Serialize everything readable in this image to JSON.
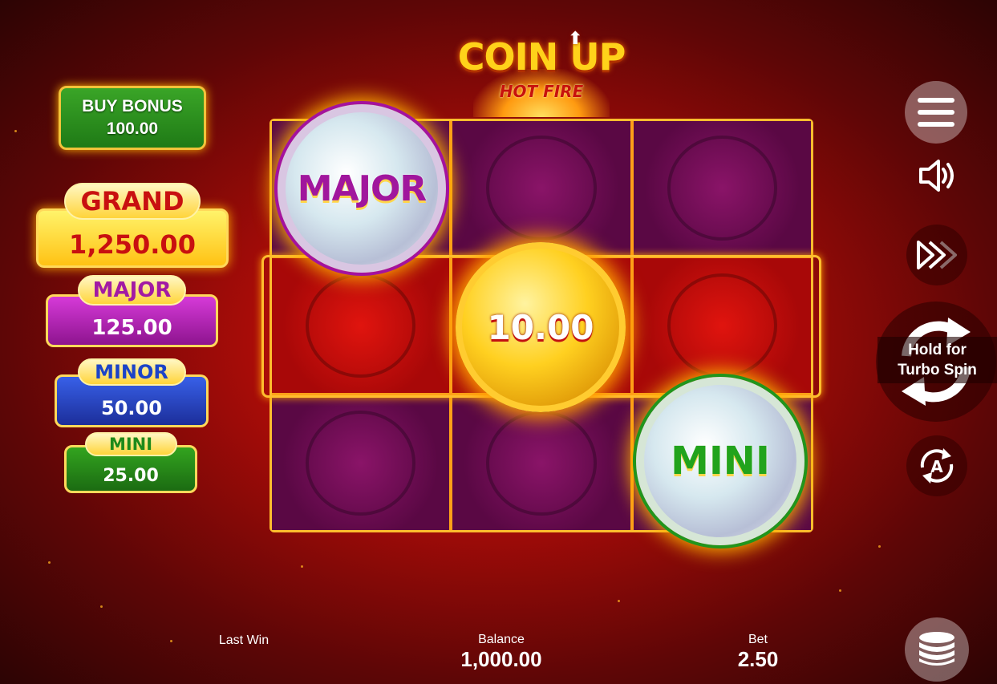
{
  "logo": {
    "title": "COIN UP",
    "subtitle": "HOT FIRE"
  },
  "buy_bonus": {
    "label": "BUY BONUS",
    "price": "100.00"
  },
  "jackpots": [
    {
      "name": "GRAND",
      "value": "1,250.00"
    },
    {
      "name": "MAJOR",
      "value": "125.00"
    },
    {
      "name": "MINOR",
      "value": "50.00"
    },
    {
      "name": "MINI",
      "value": "25.00"
    }
  ],
  "reels": {
    "rows": [
      [
        "purple",
        "purple",
        "purple"
      ],
      [
        "red",
        "red",
        "red"
      ],
      [
        "purple",
        "purple",
        "purple"
      ]
    ],
    "coins": [
      {
        "type": "jackpot",
        "label": "MAJOR",
        "row": 0,
        "col": 0
      },
      {
        "type": "cash",
        "label": "10.00",
        "row": 1,
        "col": 1
      },
      {
        "type": "jackpot",
        "label": "MINI",
        "row": 2,
        "col": 2
      }
    ]
  },
  "controls": {
    "menu_icon": "hamburger-menu-icon",
    "sound_icon": "speaker-icon",
    "fast_icon": "fast-forward-icon",
    "spin_icon": "spin-arrows-icon",
    "spin_hint_line1": "Hold for",
    "spin_hint_line2": "Turbo Spin",
    "auto_icon": "autoplay-icon",
    "auto_letter": "A",
    "bet_icon": "coin-stack-icon"
  },
  "footer": {
    "last_win_label": "Last Win",
    "last_win_value": "",
    "balance_label": "Balance",
    "balance_value": "1,000.00",
    "bet_label": "Bet",
    "bet_value": "2.50"
  },
  "colors": {
    "background_red": "#a80c08",
    "gold_border": "#ffbd2e",
    "grand": "#ffc214",
    "major": "#a21aa4",
    "minor": "#1b43c8",
    "mini": "#1e8a1a"
  }
}
